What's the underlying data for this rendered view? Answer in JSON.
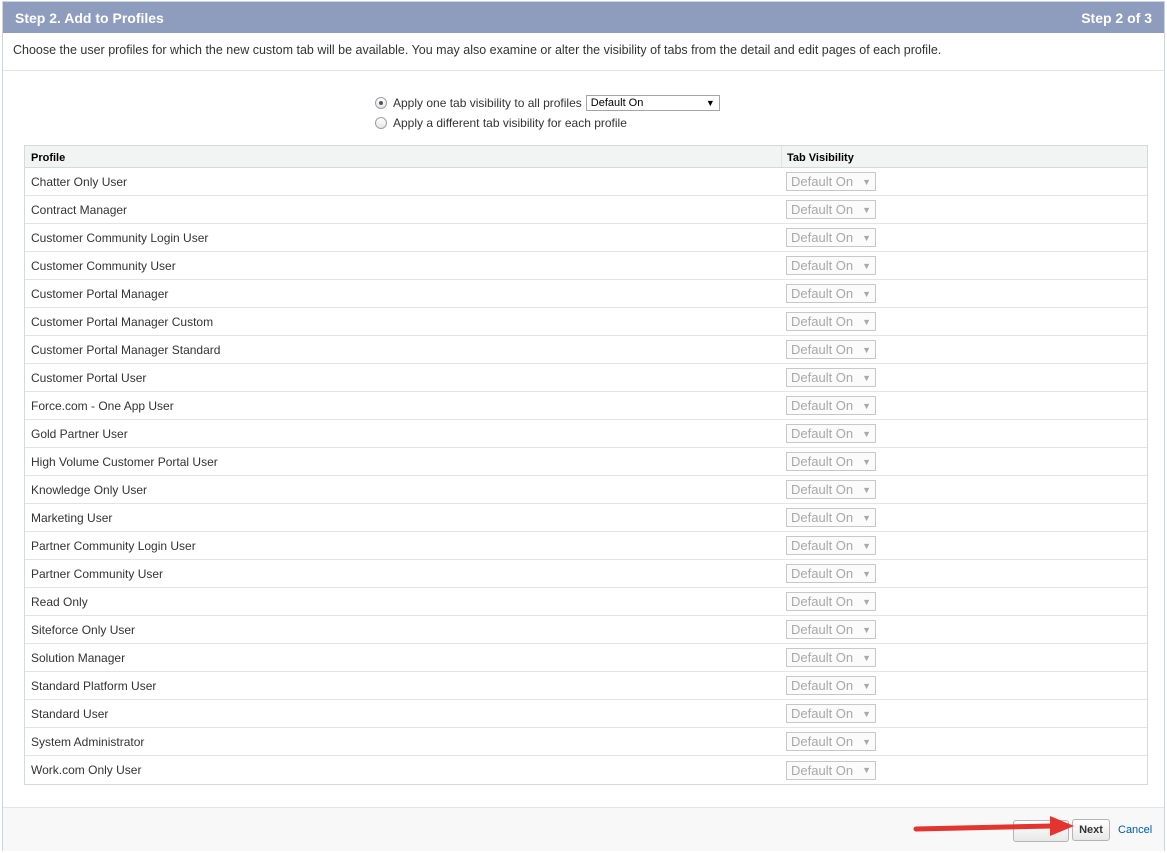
{
  "header": {
    "title": "Step 2. Add to Profiles",
    "step": "Step 2 of 3"
  },
  "description": "Choose the user profiles for which the new custom tab will be available. You may also examine or alter the visibility of tabs from the detail and edit pages of each profile.",
  "options": {
    "apply_all_label": "Apply one tab visibility to all profiles",
    "apply_all_selected": true,
    "apply_all_value": "Default On",
    "apply_each_label": "Apply a different tab visibility for each profile",
    "apply_each_selected": false
  },
  "table": {
    "headers": {
      "profile": "Profile",
      "visibility": "Tab Visibility"
    },
    "rows": [
      {
        "profile": "Chatter Only User",
        "visibility": "Default On"
      },
      {
        "profile": "Contract Manager",
        "visibility": "Default On"
      },
      {
        "profile": "Customer Community Login User",
        "visibility": "Default On"
      },
      {
        "profile": "Customer Community User",
        "visibility": "Default On"
      },
      {
        "profile": "Customer Portal Manager",
        "visibility": "Default On"
      },
      {
        "profile": "Customer Portal Manager Custom",
        "visibility": "Default On"
      },
      {
        "profile": "Customer Portal Manager Standard",
        "visibility": "Default On"
      },
      {
        "profile": "Customer Portal User",
        "visibility": "Default On"
      },
      {
        "profile": "Force.com - One App User",
        "visibility": "Default On"
      },
      {
        "profile": "Gold Partner User",
        "visibility": "Default On"
      },
      {
        "profile": "High Volume Customer Portal User",
        "visibility": "Default On"
      },
      {
        "profile": "Knowledge Only User",
        "visibility": "Default On"
      },
      {
        "profile": "Marketing User",
        "visibility": "Default On"
      },
      {
        "profile": "Partner Community Login User",
        "visibility": "Default On"
      },
      {
        "profile": "Partner Community User",
        "visibility": "Default On"
      },
      {
        "profile": "Read Only",
        "visibility": "Default On"
      },
      {
        "profile": "Siteforce Only User",
        "visibility": "Default On"
      },
      {
        "profile": "Solution Manager",
        "visibility": "Default On"
      },
      {
        "profile": "Standard Platform User",
        "visibility": "Default On"
      },
      {
        "profile": "Standard User",
        "visibility": "Default On"
      },
      {
        "profile": "System Administrator",
        "visibility": "Default On"
      },
      {
        "profile": "Work.com Only User",
        "visibility": "Default On"
      }
    ]
  },
  "footer": {
    "next_label": "Next",
    "cancel_label": "Cancel"
  },
  "colors": {
    "header_bg": "#8e9dbe",
    "annotation_arrow": "#e3342f",
    "link": "#015ba7"
  }
}
